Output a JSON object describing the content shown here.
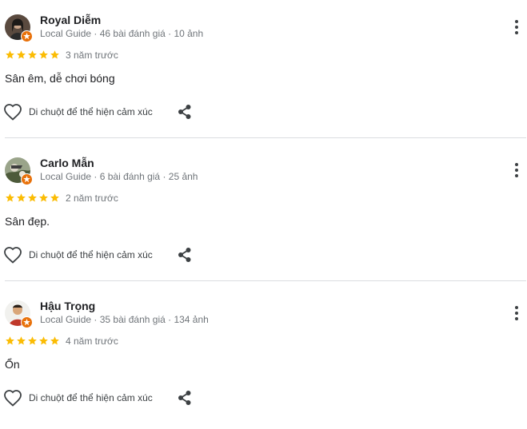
{
  "reviews": [
    {
      "name": "Royal Diễm",
      "meta": "Local Guide · 46 bài đánh giá · 10 ảnh",
      "rating": 5,
      "time": "3 năm trước",
      "text": "Sân êm, dễ chơi bóng",
      "reaction_label": "Di chuột để thể hiện cảm xúc"
    },
    {
      "name": "Carlo Mẫn",
      "meta": "Local Guide · 6 bài đánh giá · 25 ảnh",
      "rating": 5,
      "time": "2 năm trước",
      "text": "Sân đẹp.",
      "reaction_label": "Di chuột để thể hiện cảm xúc"
    },
    {
      "name": "Hậu Trọng",
      "meta": "Local Guide · 35 bài đánh giá · 134 ảnh",
      "rating": 5,
      "time": "4 năm trước",
      "text": "Ổn",
      "reaction_label": "Di chuột để thể hiện cảm xúc"
    }
  ],
  "colors": {
    "star": "#fbbc04",
    "guide_badge": "#e8710a",
    "meta_text": "#70757a",
    "divider": "#dadce0"
  },
  "icons": {
    "more": "more-vert-icon",
    "like": "heart-outline-icon",
    "share": "share-icon",
    "star": "star-icon",
    "badge": "local-guide-badge-icon"
  }
}
